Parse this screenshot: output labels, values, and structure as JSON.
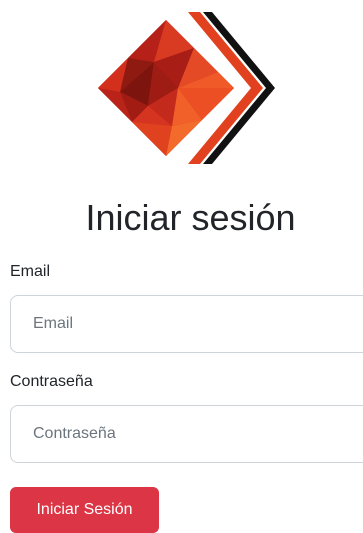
{
  "login": {
    "title": "Iniciar sesión",
    "email_label": "Email",
    "email_placeholder": "Email",
    "email_value": "",
    "password_label": "Contraseña",
    "password_placeholder": "Contraseña",
    "password_value": "",
    "submit_label": "Iniciar Sesión"
  },
  "icons": {
    "logo": "red-faceted-diamond-with-chevrons-logo"
  },
  "colors": {
    "button": "#dc3545",
    "logo_primary": "#c8281e",
    "logo_dark": "#8e1a12",
    "logo_chevron_black": "#111111"
  }
}
